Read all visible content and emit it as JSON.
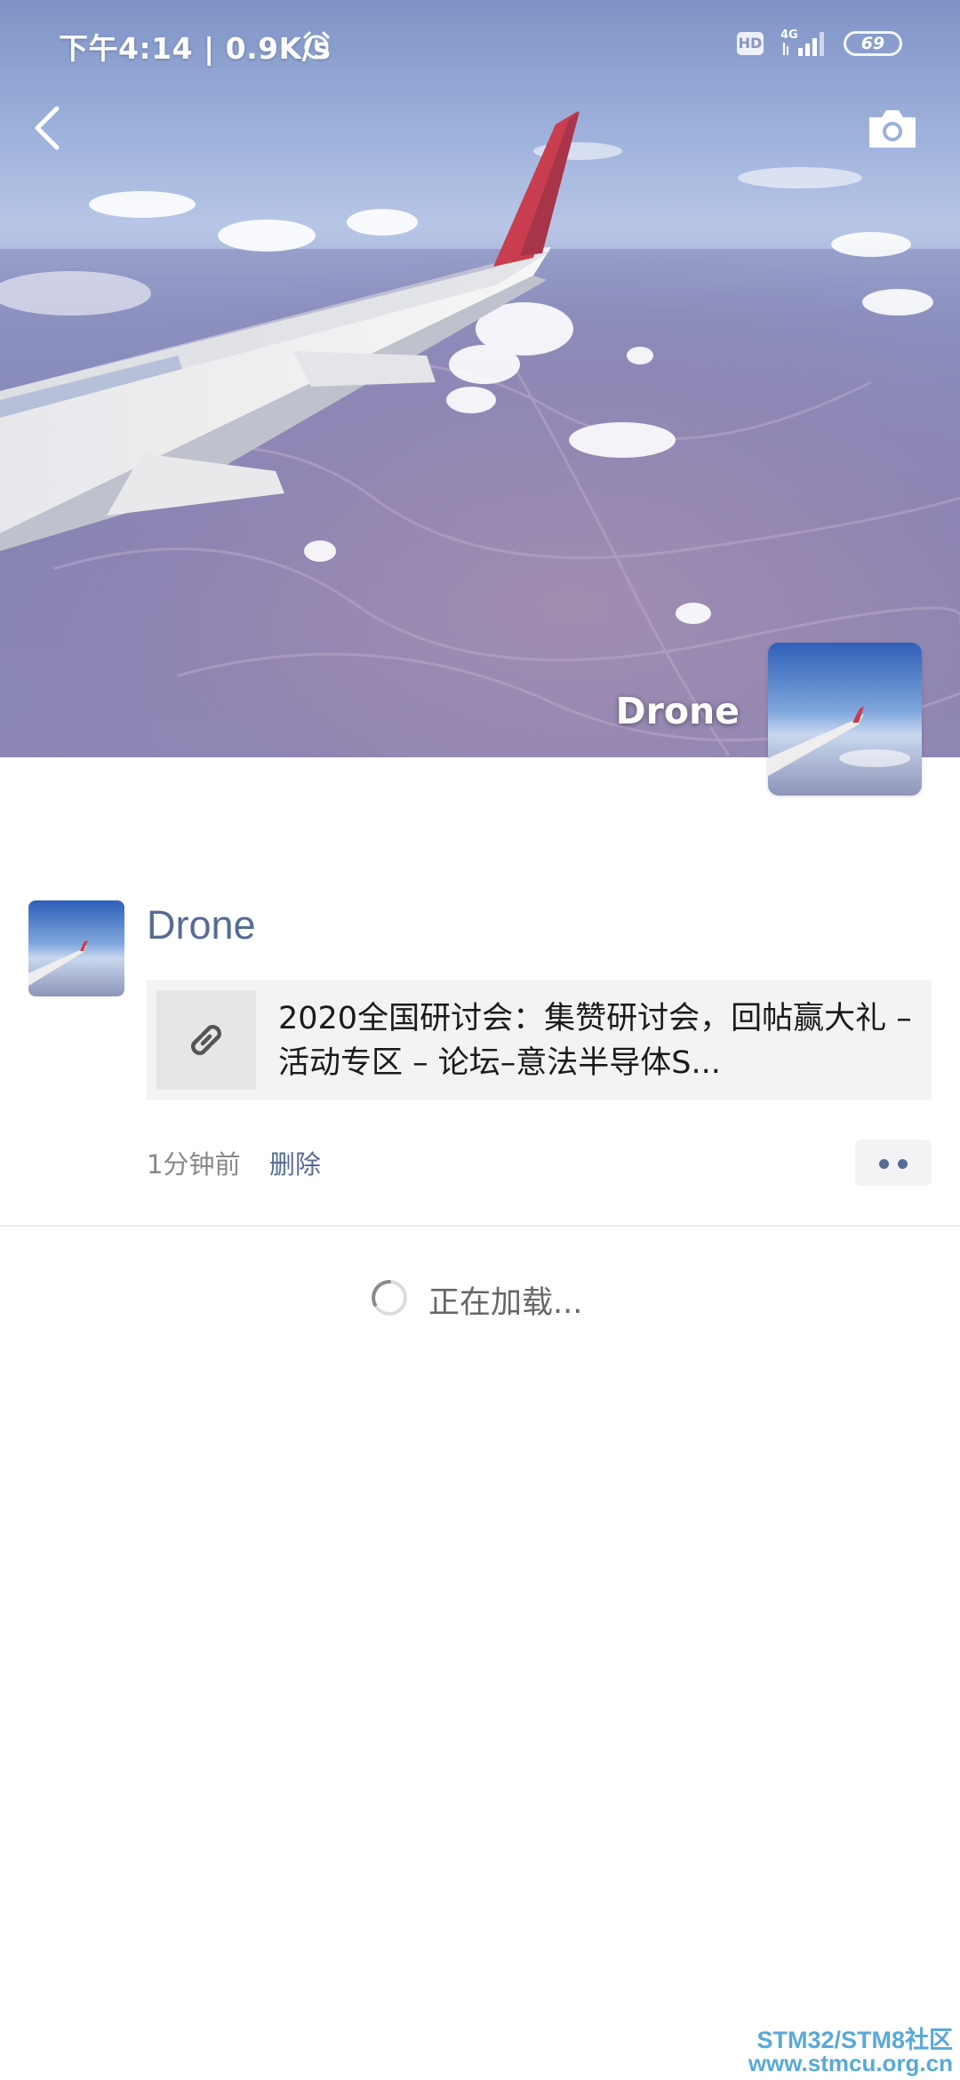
{
  "status_bar": {
    "time": "下午4:14 | 0.9K/s",
    "hd": "HD",
    "network": "4G",
    "battery": "69"
  },
  "profile": {
    "name": "Drone"
  },
  "post": {
    "author": "Drone",
    "link_title": "2020全国研讨会：集赞研讨会，回帖赢大礼 – 活动专区 – 论坛–意法半导体S...",
    "time": "1分钟前",
    "delete_label": "删除"
  },
  "loading": {
    "text": "正在加载..."
  },
  "watermark": {
    "line1": "STM32/STM8社区",
    "line2": "www.stmcu.org.cn"
  },
  "colors": {
    "link_blue": "#576b95",
    "card_bg": "#f3f3f5",
    "watermark": "#5aa9d8"
  }
}
